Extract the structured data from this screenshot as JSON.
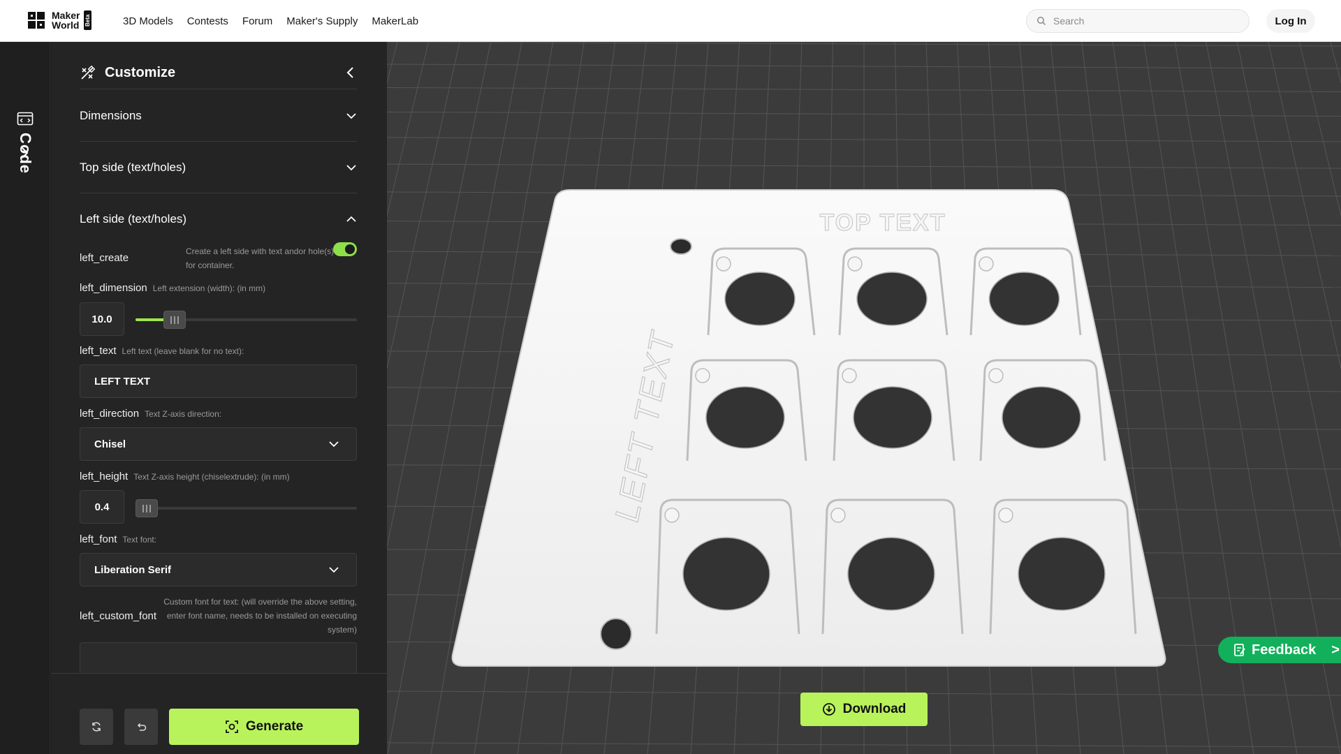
{
  "header": {
    "logo_line1": "Maker",
    "logo_line2": "World",
    "logo_badge": "Beta",
    "nav": [
      "3D Models",
      "Contests",
      "Forum",
      "Maker's Supply",
      "MakerLab"
    ],
    "search_placeholder": "Search",
    "login_label": "Log In"
  },
  "rail": {
    "code_label": "Code"
  },
  "panel": {
    "title": "Customize",
    "sections": {
      "dimensions": "Dimensions",
      "top_side": "Top side (text/holes)",
      "left_side": "Left side (text/holes)"
    },
    "fields": {
      "left_create": {
        "name": "left_create",
        "desc": "Create a left side with text andor hole(s) for container.",
        "enabled": true
      },
      "left_dimension": {
        "name": "left_dimension",
        "desc": "Left extension (width): (in mm)",
        "value": "10.0",
        "fill": 0.14
      },
      "left_text": {
        "name": "left_text",
        "desc": "Left text (leave blank for no text):",
        "value": "LEFT TEXT"
      },
      "left_direction": {
        "name": "left_direction",
        "desc": "Text Z-axis direction:",
        "value": "Chisel"
      },
      "left_height": {
        "name": "left_height",
        "desc": "Text Z-axis height (chiselextrude): (in mm)",
        "value": "0.4",
        "fill": 0.01
      },
      "left_font": {
        "name": "left_font",
        "desc": "Text font:",
        "value": "Liberation Serif"
      },
      "left_custom_font": {
        "name": "left_custom_font",
        "desc": "Custom font for text: (will override the above setting, enter font name, needs to be installed on executing system)",
        "value": ""
      }
    },
    "generate_label": "Generate"
  },
  "viewport": {
    "model_top_text": "TOP TEXT",
    "model_left_text": "LEFT TEXT",
    "download_label": "Download",
    "feedback_label": "Feedback",
    "feedback_arrow": ">"
  },
  "colors": {
    "accent": "#b9f35c",
    "feedback": "#12b05a",
    "panel_bg": "#242424",
    "viewport_bg": "#3b3b3b"
  }
}
